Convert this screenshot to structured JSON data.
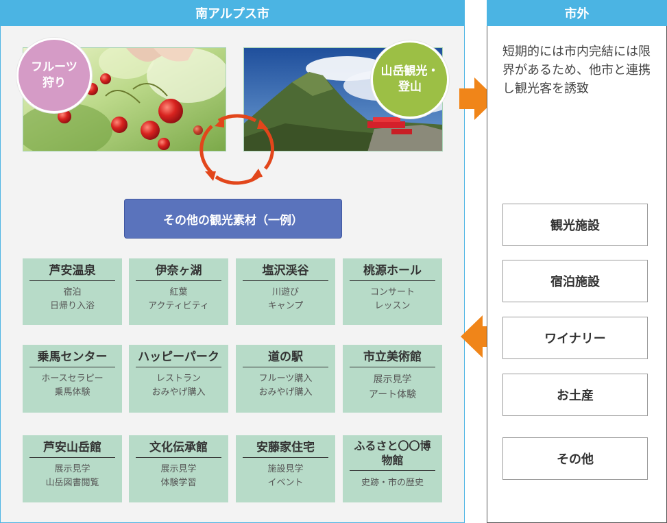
{
  "city_panel": {
    "title": "南アルプス市",
    "badge_fruit": "フルーツ狩り",
    "badge_mountain": "山岳観光・登山",
    "example_banner": "その他の観光素材（一例）",
    "tiles": [
      {
        "title": "芦安温泉",
        "desc": [
          "宿泊",
          "日帰り入浴"
        ]
      },
      {
        "title": "伊奈ヶ湖",
        "desc": [
          "紅葉",
          "アクティビティ"
        ]
      },
      {
        "title": "塩沢渓谷",
        "desc": [
          "川遊び",
          "キャンプ"
        ]
      },
      {
        "title": "桃源ホール",
        "desc": [
          "コンサート",
          "レッスン"
        ]
      },
      {
        "title": "乗馬センター",
        "desc": [
          "ホースセラピー",
          "乗馬体験"
        ]
      },
      {
        "title": "ハッピーパーク",
        "desc": [
          "レストラン",
          "おみやげ購入"
        ]
      },
      {
        "title": "道の駅",
        "desc": [
          "フルーツ購入",
          "おみやげ購入"
        ]
      },
      {
        "title": "市立美術館",
        "desc": [
          "展示見学",
          "アート体験"
        ]
      },
      {
        "title": "芦安山岳館",
        "desc": [
          "展示見学",
          "山岳図書閲覧"
        ]
      },
      {
        "title": "文化伝承館",
        "desc": [
          "展示見学",
          "体験学習"
        ]
      },
      {
        "title": "安藤家住宅",
        "desc": [
          "施設見学",
          "イベント"
        ]
      },
      {
        "title": "ふるさと〇〇博物館",
        "desc": [
          "史跡・市の歴史"
        ]
      }
    ]
  },
  "outside_panel": {
    "title": "市外",
    "note": "短期的には市内完結には限界があるため、他市と連携し観光客を誘致",
    "categories": [
      "観光施設",
      "宿泊施設",
      "ワイナリー",
      "お土産",
      "その他"
    ]
  },
  "colors": {
    "header_blue": "#4bb4e3",
    "arrow_orange": "#f08519",
    "cycle_red": "#e2461b",
    "tile_green": "#b7dbc8",
    "banner_blue": "#5a73bc",
    "badge_pink": "#d59bc6",
    "badge_green": "#9cbf45"
  }
}
